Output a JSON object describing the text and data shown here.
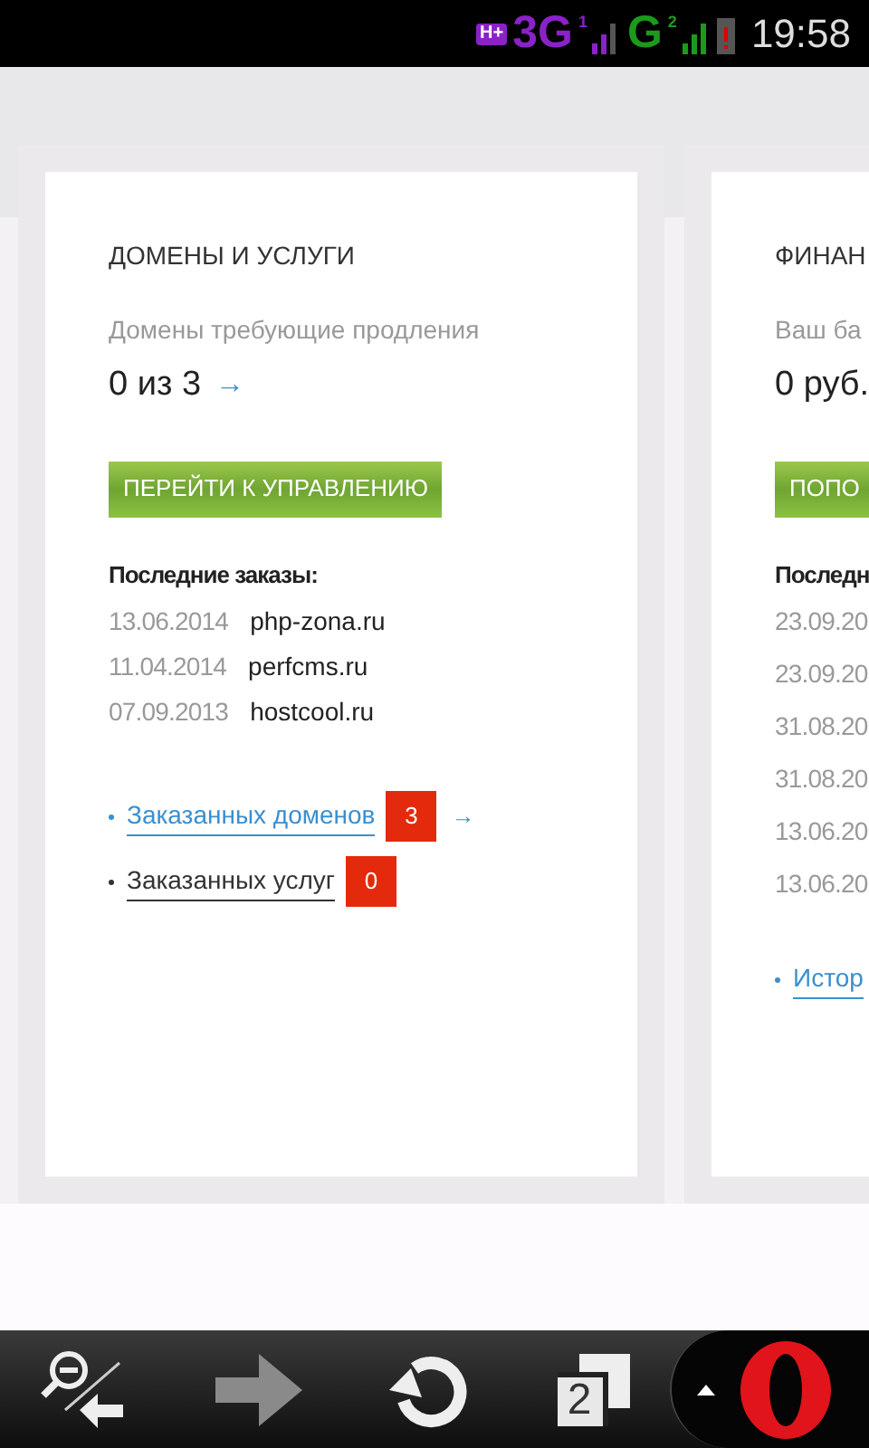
{
  "status_bar": {
    "network_badge": "H+",
    "network_1": "3G",
    "sim_1": "1",
    "network_2": "G",
    "sim_2": "2",
    "time": "19:58"
  },
  "cards": [
    {
      "title": "ДОМЕНЫ И УСЛУГИ",
      "subtitle": "Домены требующие продления",
      "value": "0 из 3",
      "value_arrow": "→",
      "button": "ПЕРЕЙТИ К УПРАВЛЕНИЮ",
      "list_title": "Последние заказы:",
      "rows": [
        {
          "date": "13.06.2014",
          "name": "php-zona.ru"
        },
        {
          "date": "11.04.2014",
          "name": "perfcms.ru"
        },
        {
          "date": "07.09.2013",
          "name": "hostcool.ru"
        }
      ],
      "links": [
        {
          "kind": "link",
          "label": "Заказанных доменов",
          "count": "3",
          "arrow": "→"
        },
        {
          "kind": "plain",
          "label": "Заказанных услуг",
          "count": "0"
        }
      ]
    },
    {
      "title": "ФИНАН",
      "subtitle": "Ваш ба",
      "value": "0 руб.",
      "button": "ПОПО",
      "list_title": "Последн",
      "rows": [
        {
          "date": "23.09.20"
        },
        {
          "date": "23.09.20"
        },
        {
          "date": "31.08.20"
        },
        {
          "date": "31.08.20"
        },
        {
          "date": "13.06.20"
        },
        {
          "date": "13.06.20"
        }
      ],
      "links": [
        {
          "kind": "link",
          "label": "Истор"
        }
      ]
    }
  ],
  "toolbar": {
    "forward_disabled": true,
    "tab_count": "2"
  }
}
